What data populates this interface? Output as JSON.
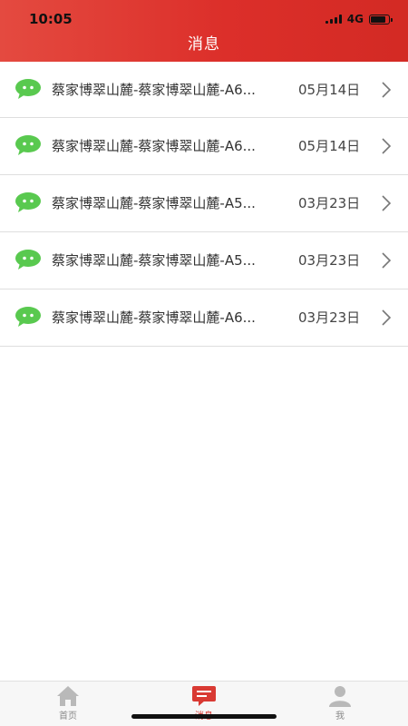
{
  "status": {
    "time": "10:05",
    "network": "4G"
  },
  "header": {
    "title": "消息"
  },
  "messages": [
    {
      "title": "蔡家博翠山麓-蔡家博翠山麓-A6...",
      "date": "05月14日"
    },
    {
      "title": "蔡家博翠山麓-蔡家博翠山麓-A6...",
      "date": "05月14日"
    },
    {
      "title": "蔡家博翠山麓-蔡家博翠山麓-A5...",
      "date": "03月23日"
    },
    {
      "title": "蔡家博翠山麓-蔡家博翠山麓-A5...",
      "date": "03月23日"
    },
    {
      "title": "蔡家博翠山麓-蔡家博翠山麓-A6...",
      "date": "03月23日"
    }
  ],
  "tabs": [
    {
      "label": "首页",
      "icon": "home-icon"
    },
    {
      "label": "消息",
      "icon": "message-icon",
      "active": true
    },
    {
      "label": "我",
      "icon": "user-icon"
    }
  ],
  "colors": {
    "header": "#dc2f2a",
    "chat_icon": "#59c94f",
    "active_tab": "#d93a33"
  }
}
